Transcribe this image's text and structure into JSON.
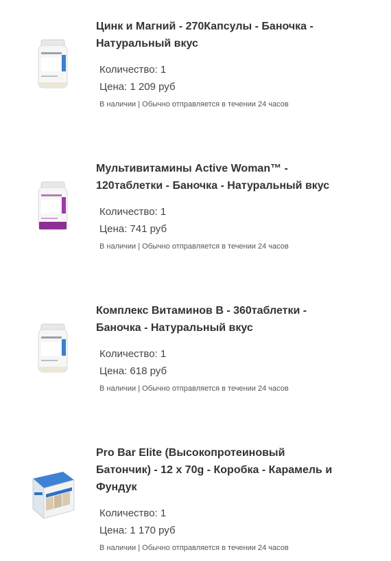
{
  "labels": {
    "quantity": "Количество:",
    "price": "Цена:"
  },
  "items": [
    {
      "title_line1": "Цинк и Магний - 270Капсулы - Баночка -",
      "title_line2": "Натуральный вкус",
      "title_line3": "",
      "quantity": "1",
      "price": "1 209 руб",
      "availability": "В наличии | Обычно отправляется в течении 24 часов",
      "image_icon": "supplement-bottle-icon",
      "accent": "#3a7fd0"
    },
    {
      "title_line1": "Мультивитамины Active Woman™ -",
      "title_line2": "120таблетки - Баночка - Натуральный вкус",
      "title_line3": "",
      "quantity": "1",
      "price": "741 руб",
      "availability": "В наличии | Обычно отправляется в течении 24 часов",
      "image_icon": "supplement-bottle-icon",
      "accent": "#a03aa8"
    },
    {
      "title_line1": "Комплекс Витаминов B - 360таблетки -",
      "title_line2": "Баночка - Натуральный вкус",
      "title_line3": "",
      "quantity": "1",
      "price": "618 руб",
      "availability": "В наличии | Обычно отправляется в течении 24 часов",
      "image_icon": "supplement-bottle-icon",
      "accent": "#3a7fd0"
    },
    {
      "title_line1": "Pro Bar Elite (Высокопротеиновый",
      "title_line2": "Батончик) - 12 x 70g - Коробка - Карамель и",
      "title_line3": "Фундук",
      "quantity": "1",
      "price": "1 170 руб",
      "availability": "В наличии | Обычно отправляется в течении 24 часов",
      "image_icon": "protein-bar-box-icon",
      "accent": "#2f6fc4"
    }
  ]
}
